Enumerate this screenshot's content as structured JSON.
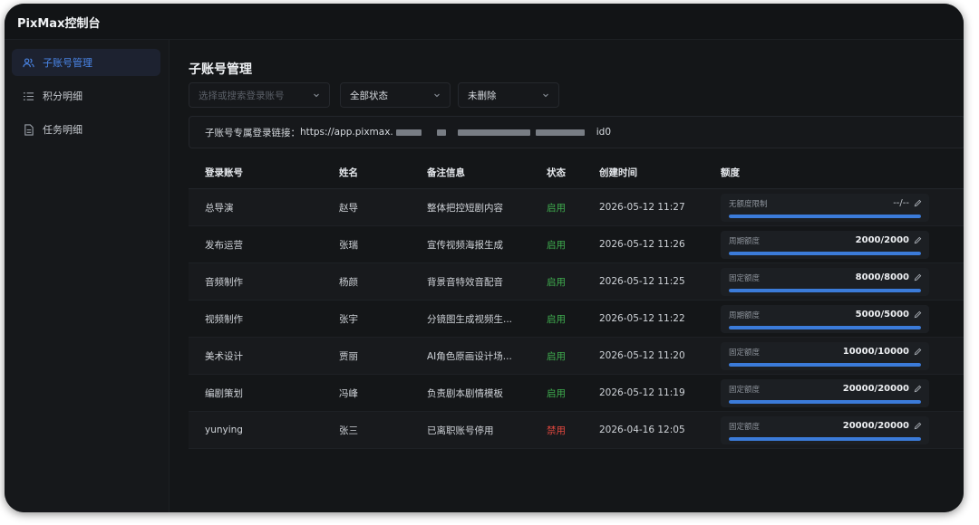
{
  "app": {
    "title": "PixMax控制台"
  },
  "sidebar": {
    "items": [
      {
        "label": "子账号管理",
        "icon": "users-icon",
        "active": true
      },
      {
        "label": "积分明细",
        "icon": "list-icon",
        "active": false
      },
      {
        "label": "任务明细",
        "icon": "document-icon",
        "active": false
      }
    ]
  },
  "page": {
    "title": "子账号管理"
  },
  "filters": {
    "account": {
      "placeholder": "选择或搜索登录账号"
    },
    "status": {
      "value": "全部状态"
    },
    "deleted": {
      "value": "未删除"
    }
  },
  "link": {
    "label": "子账号专属登录链接：",
    "prefix": "https://app.pixmax.",
    "suffix": "id0"
  },
  "table": {
    "headers": [
      "登录账号",
      "姓名",
      "备注信息",
      "状态",
      "创建时间",
      "额度"
    ],
    "rows": [
      {
        "account": "总导演",
        "name": "赵导",
        "note": "整体把控短剧内容",
        "status": "启用",
        "status_key": "on",
        "created": "2026-05-12 11:27",
        "quota_type": "无额度限制",
        "quota": "--/--",
        "used_ratio": 1.0
      },
      {
        "account": "发布运营",
        "name": "张瑞",
        "note": "宣传视频海报生成",
        "status": "启用",
        "status_key": "on",
        "created": "2026-05-12 11:26",
        "quota_type": "周期额度",
        "quota": "2000/2000",
        "used_ratio": 1.0
      },
      {
        "account": "音频制作",
        "name": "杨颜",
        "note": "背景音特效音配音",
        "status": "启用",
        "status_key": "on",
        "created": "2026-05-12 11:25",
        "quota_type": "固定额度",
        "quota": "8000/8000",
        "used_ratio": 1.0
      },
      {
        "account": "视频制作",
        "name": "张宇",
        "note": "分镜图生成视频生...",
        "status": "启用",
        "status_key": "on",
        "created": "2026-05-12 11:22",
        "quota_type": "周期额度",
        "quota": "5000/5000",
        "used_ratio": 1.0
      },
      {
        "account": "美术设计",
        "name": "贾丽",
        "note": "AI角色原画设计场...",
        "status": "启用",
        "status_key": "on",
        "created": "2026-05-12 11:20",
        "quota_type": "固定额度",
        "quota": "10000/10000",
        "used_ratio": 1.0
      },
      {
        "account": "编剧策划",
        "name": "冯峰",
        "note": "负责剧本剧情模板",
        "status": "启用",
        "status_key": "on",
        "created": "2026-05-12 11:19",
        "quota_type": "固定额度",
        "quota": "20000/20000",
        "used_ratio": 1.0
      },
      {
        "account": "yunying",
        "name": "张三",
        "note": "已离职账号停用",
        "status": "禁用",
        "status_key": "off",
        "created": "2026-04-16 12:05",
        "quota_type": "固定额度",
        "quota": "20000/20000",
        "used_ratio": 1.0
      }
    ]
  },
  "colors": {
    "accent": "#4a86e8",
    "enabled": "#3fae4f",
    "disabled": "#e5483f",
    "bar": "#3b7bd9"
  }
}
